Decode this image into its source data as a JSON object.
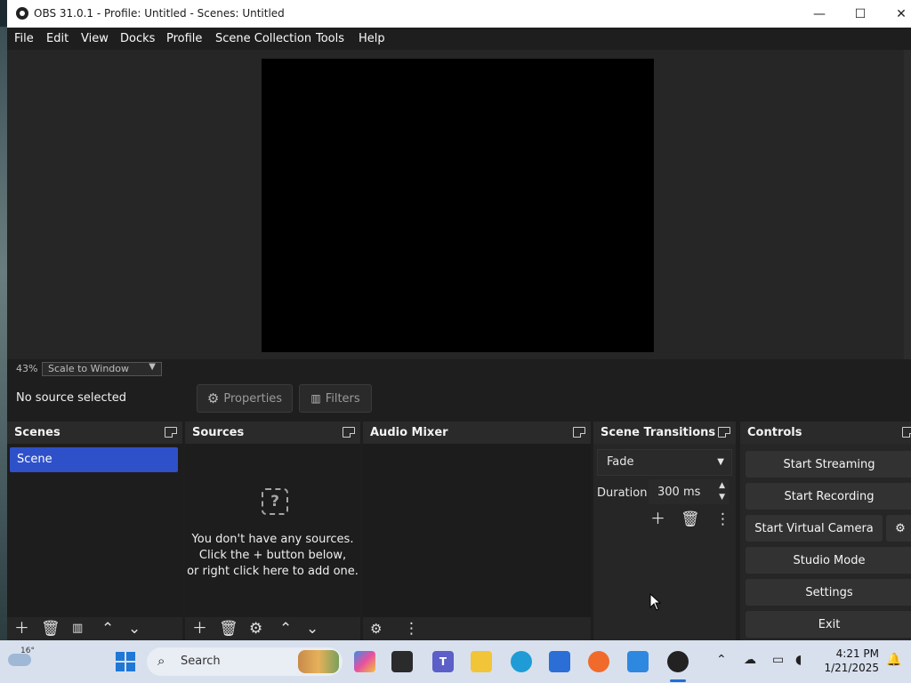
{
  "window": {
    "title": "OBS 31.0.1 - Profile: Untitled - Scenes: Untitled",
    "controls": {
      "minimize": "—",
      "maximize": "☐",
      "close": "✕"
    }
  },
  "menu": [
    "File",
    "Edit",
    "View",
    "Docks",
    "Profile",
    "Scene Collection",
    "Tools",
    "Help"
  ],
  "preview": {
    "zoom": "43%",
    "scale_mode": "Scale to Window"
  },
  "source_toolbar": {
    "status": "No source selected",
    "properties": "Properties",
    "filters": "Filters"
  },
  "docks": {
    "scenes": {
      "title": "Scenes",
      "items": [
        "Scene"
      ]
    },
    "sources": {
      "title": "Sources",
      "empty_message": [
        "You don't have any sources.",
        "Click the + button below,",
        "or right click here to add one."
      ]
    },
    "audio_mixer": {
      "title": "Audio Mixer"
    },
    "transitions": {
      "title": "Scene Transitions",
      "selected": "Fade",
      "duration_label": "Duration",
      "duration_value": "300 ms"
    },
    "controls": {
      "title": "Controls",
      "buttons": [
        "Start Streaming",
        "Start Recording",
        "Start Virtual Camera",
        "Studio Mode",
        "Settings",
        "Exit"
      ]
    }
  },
  "taskbar": {
    "weather": "16°",
    "search_placeholder": "Search",
    "time": "4:21 PM",
    "date": "1/21/2025",
    "icons": [
      "windows-start",
      "search",
      "copilot",
      "terminal",
      "teams",
      "file-explorer",
      "edge",
      "microsoft-store",
      "firefox",
      "notepad",
      "obs"
    ]
  }
}
